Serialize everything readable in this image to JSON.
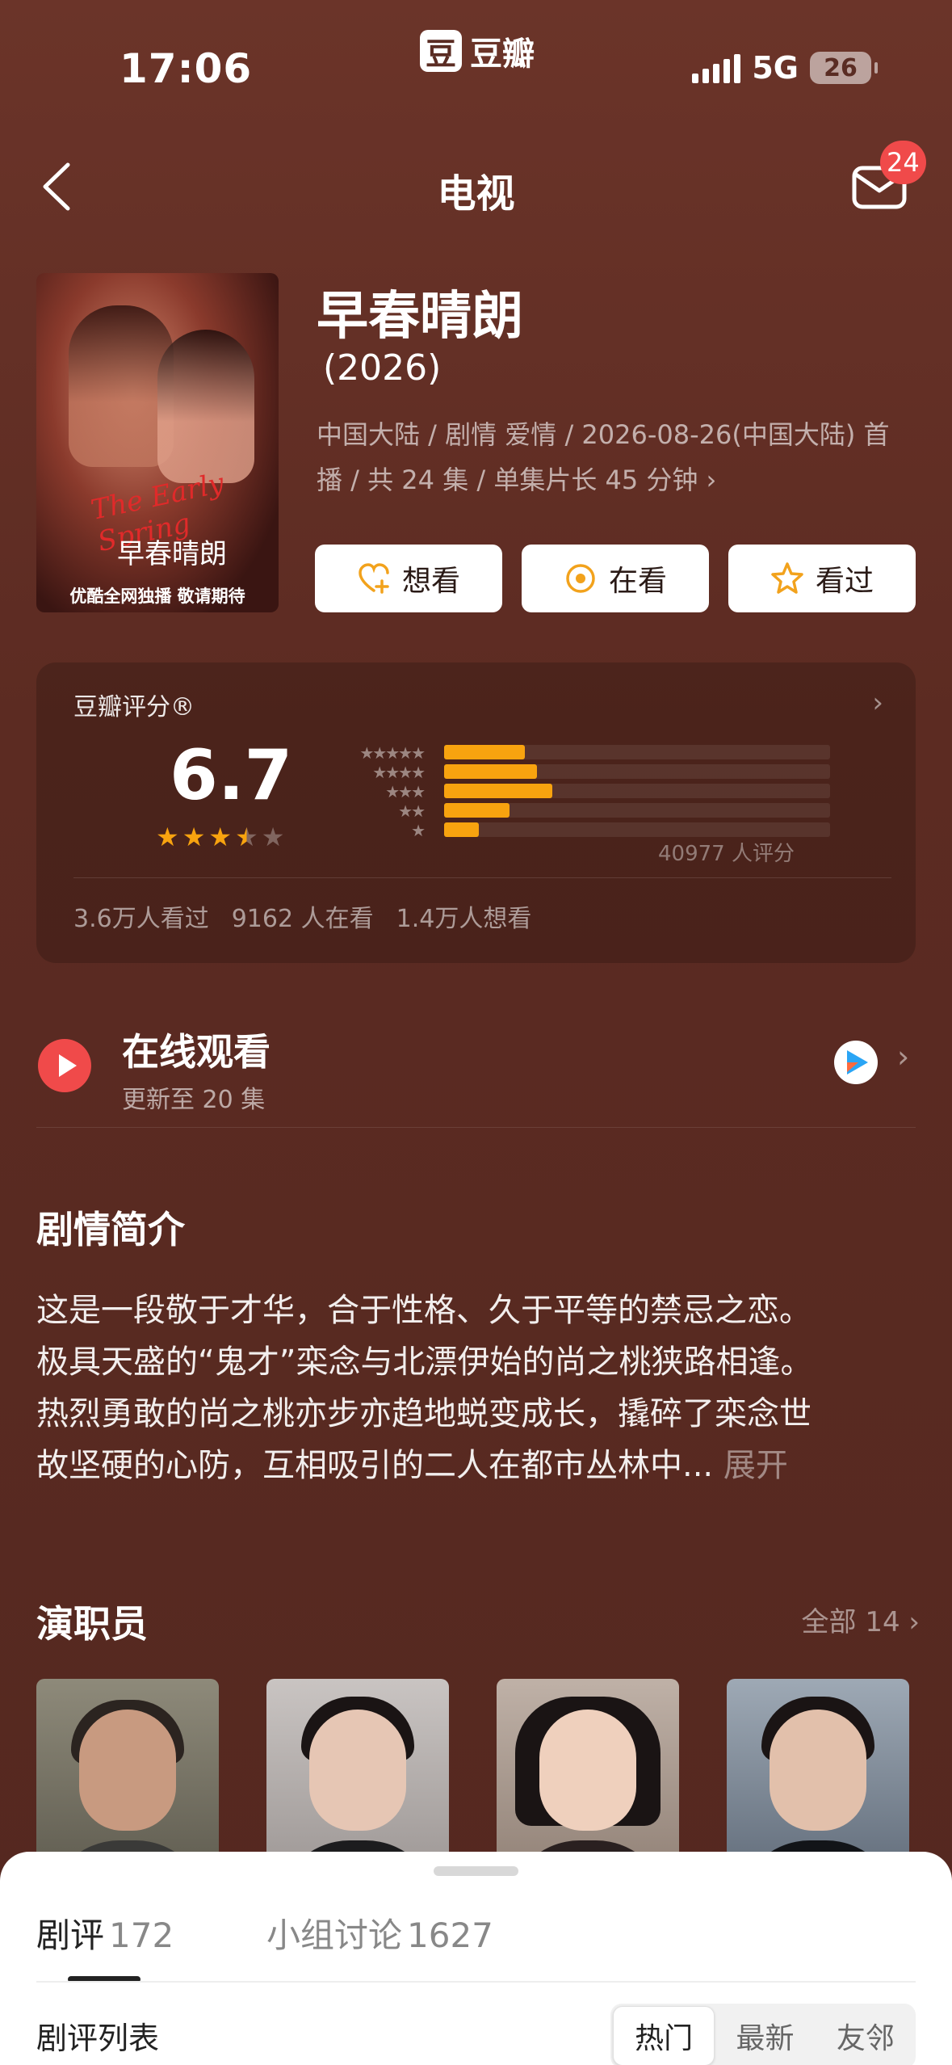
{
  "status_bar": {
    "time": "17:06",
    "app_name": "豆瓣",
    "app_logo_char": "豆",
    "network": "5G",
    "battery": "26"
  },
  "nav": {
    "title": "电视",
    "mail_badge": "24"
  },
  "poster": {
    "script_text": "The Early Spring",
    "cn_text": "早春晴朗",
    "tagline": "优酷全网独播 敬请期待"
  },
  "show": {
    "title": "早春晴朗",
    "year": "(2026)",
    "meta": "中国大陆 / 剧情 爱情 / 2026-08-26(中国大陆) 首播 / 共 24 集 / 单集片长 45 分钟 ›"
  },
  "actions": [
    {
      "label": "想看",
      "icon": "heart-plus-icon"
    },
    {
      "label": "在看",
      "icon": "target-icon"
    },
    {
      "label": "看过",
      "icon": "star-icon"
    }
  ],
  "rating": {
    "label": "豆瓣评分®",
    "score": "6.7",
    "stars": 3.5,
    "count_text": "40977 人评分",
    "distribution": [
      {
        "stars": 5,
        "fraction": 0.21
      },
      {
        "stars": 4,
        "fraction": 0.24
      },
      {
        "stars": 3,
        "fraction": 0.28
      },
      {
        "stars": 2,
        "fraction": 0.17
      },
      {
        "stars": 1,
        "fraction": 0.09
      }
    ],
    "stats": [
      "3.6万人看过",
      "9162 人在看",
      "1.4万人想看"
    ],
    "star_color": "#f8a30f"
  },
  "watch": {
    "title": "在线观看",
    "subtitle": "更新至 20 集",
    "accent": "#f04a4a"
  },
  "synopsis": {
    "title": "剧情简介",
    "lines": [
      "这是一段敬于才华，合于性格、久于平等的禁忌之恋。",
      "极具天盛的“鬼才”栾念与北漂伊始的尚之桃狭路相逢。",
      "热烈勇敢的尚之桃亦步亦趋地蜕变成长，撬碎了栾念世",
      "故坚硬的心防，互相吸引的二人在都市丛林中..."
    ],
    "more": " 展开"
  },
  "cast": {
    "title": "演职员",
    "all_label": "全部 14 ›"
  },
  "sheet": {
    "tabs": [
      {
        "label": "剧评",
        "count": "172"
      },
      {
        "label": "小组讨论",
        "count": "1627"
      }
    ],
    "list_label": "剧评列表",
    "sort_options": [
      "热门",
      "最新",
      "友邻"
    ]
  }
}
